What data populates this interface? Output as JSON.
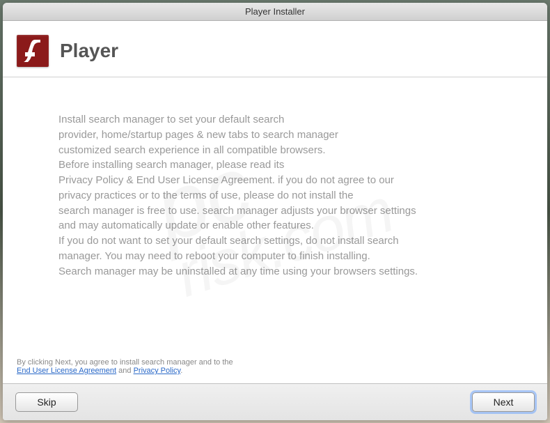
{
  "window": {
    "title": "Player Installer"
  },
  "header": {
    "title": "Player",
    "icon_name": "flash-icon"
  },
  "body": {
    "line1": "Install search manager to set your default search",
    "line2": "provider, home/startup pages & new tabs to search manager",
    "line3": "customized search experience in all compatible browsers.",
    "line4": "Before installing search manager, please read its",
    "line5": "Privacy Policy & End User License Agreement. if you do not agree to our",
    "line6": "privacy practices or to the terms of use, please do not install the",
    "line7": "search manager is free to use. search manager adjusts your browser settings",
    "line8": "and may automatically update or enable other features.",
    "line9": "If you do not want to set your default search settings, do not install search",
    "line10": "manager. You may need to reboot your computer to finish installing.",
    "line11": "Search manager may be uninstalled at any time using your browsers settings."
  },
  "footer": {
    "prefix": "By clicking Next, you agree to install search manager and to the",
    "link1": "End User License Agreement",
    "and": " and ",
    "link2": "Privacy Policy",
    "suffix": "."
  },
  "buttons": {
    "skip": "Skip",
    "next": "Next"
  },
  "watermark": {
    "line1": "pc",
    "line2": "risk.com"
  }
}
